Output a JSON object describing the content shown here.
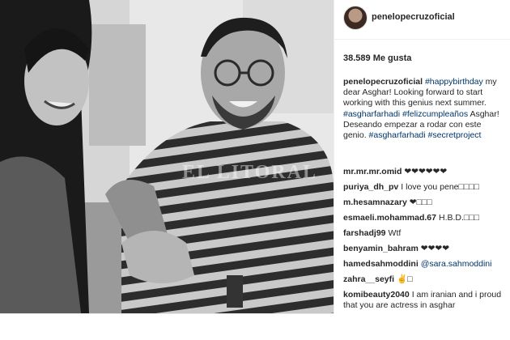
{
  "post": {
    "username": "penelopecruzoficial",
    "likes": "38.589 Me gusta",
    "watermark": "EL LITORAL",
    "caption": {
      "user": "penelopecruzoficial",
      "t1": "#happybirthday",
      "t2": " my dear Asghar! Looking forward to start working with this genius next summer. ",
      "t3": "#asgharfarhadi",
      "t4": " ",
      "t5": "#felizcumpleaños",
      "t6": " Asghar! Deseando empezar a rodar con este genio. ",
      "t7": "#asgharfarhadi",
      "t8": " ",
      "t9": "#secretproject"
    },
    "comments": [
      {
        "user": "mr.mr.mr.omid",
        "text": "❤❤❤❤❤❤"
      },
      {
        "user": "puriya_dh_pv",
        "text": "I love you pene□□□□"
      },
      {
        "user": "m.hesamnazary",
        "text": "❤□□□"
      },
      {
        "user": "esmaeli.mohammad.67",
        "text": "H.B.D.□□□"
      },
      {
        "user": "farshadj99",
        "text": "Wtf"
      },
      {
        "user": "benyamin_bahram",
        "text": "❤❤❤❤"
      },
      {
        "user": "hamedsahmoddini",
        "text": "@sara.sahmoddini"
      },
      {
        "user": "zahra__seyfi",
        "text": "✌□"
      },
      {
        "user": "komibeauty2040",
        "text": "I am iranian and i proud that you are actress in asghar"
      }
    ]
  }
}
